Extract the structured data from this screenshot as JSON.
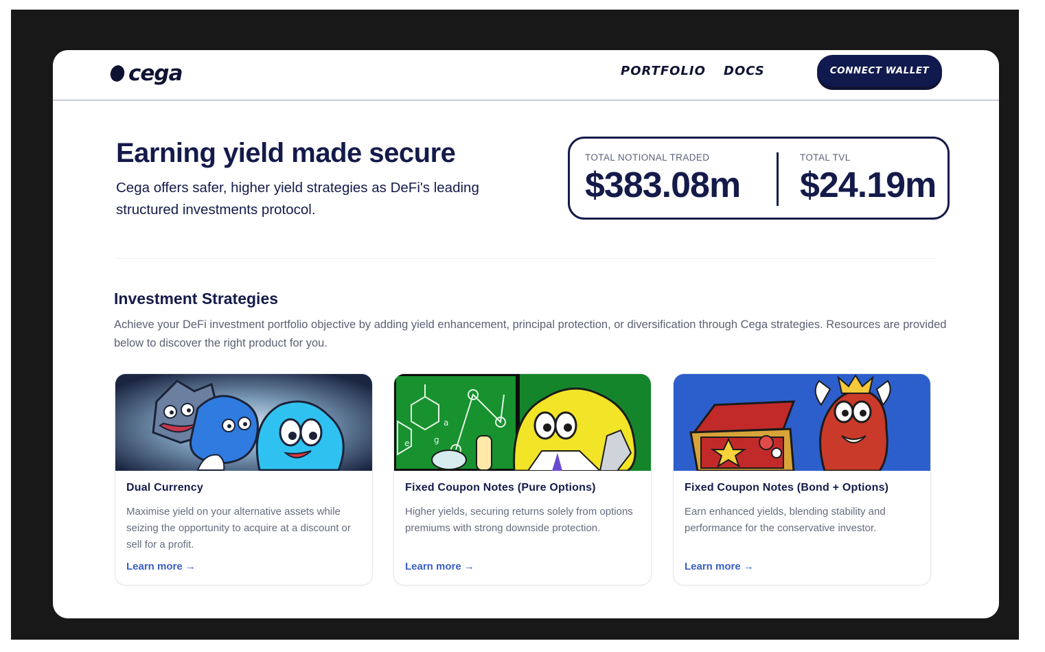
{
  "header": {
    "logo_text": "cega",
    "nav": [
      "PORTFOLIO",
      "DOCS"
    ],
    "connect_label": "CONNECT WALLET"
  },
  "hero": {
    "title": "Earning yield made secure",
    "subtitle": "Cega offers safer, higher yield strategies as DeFi's leading structured investments protocol."
  },
  "stats": [
    {
      "label": "TOTAL NOTIONAL TRADED",
      "value": "$383.08m"
    },
    {
      "label": "TOTAL TVL",
      "value": "$24.19m"
    }
  ],
  "strategies": {
    "title": "Investment Strategies",
    "description": "Achieve your DeFi investment portfolio objective by adding yield enhancement, principal protection, or diversification through Cega strategies. Resources are provided below to discover the right product for you.",
    "cards": [
      {
        "title": "Dual Currency",
        "description": "Maximise yield on your alternative assets while seizing the opportunity to acquire at a discount or sell for a profit.",
        "link": "Learn more →"
      },
      {
        "title": "Fixed Coupon Notes (Pure Options)",
        "description": "Higher yields, securing returns solely from options premiums with strong downside protection.",
        "link": "Learn more →"
      },
      {
        "title": "Fixed Coupon Notes (Bond + Options)",
        "description": "Earn enhanced yields, blending stability and performance for the conservative investor.",
        "link": "Learn more →"
      }
    ]
  },
  "colors": {
    "navy": "#141b4a",
    "button": "#111a4e",
    "link": "#3a5fc4",
    "frame": "#181818"
  }
}
